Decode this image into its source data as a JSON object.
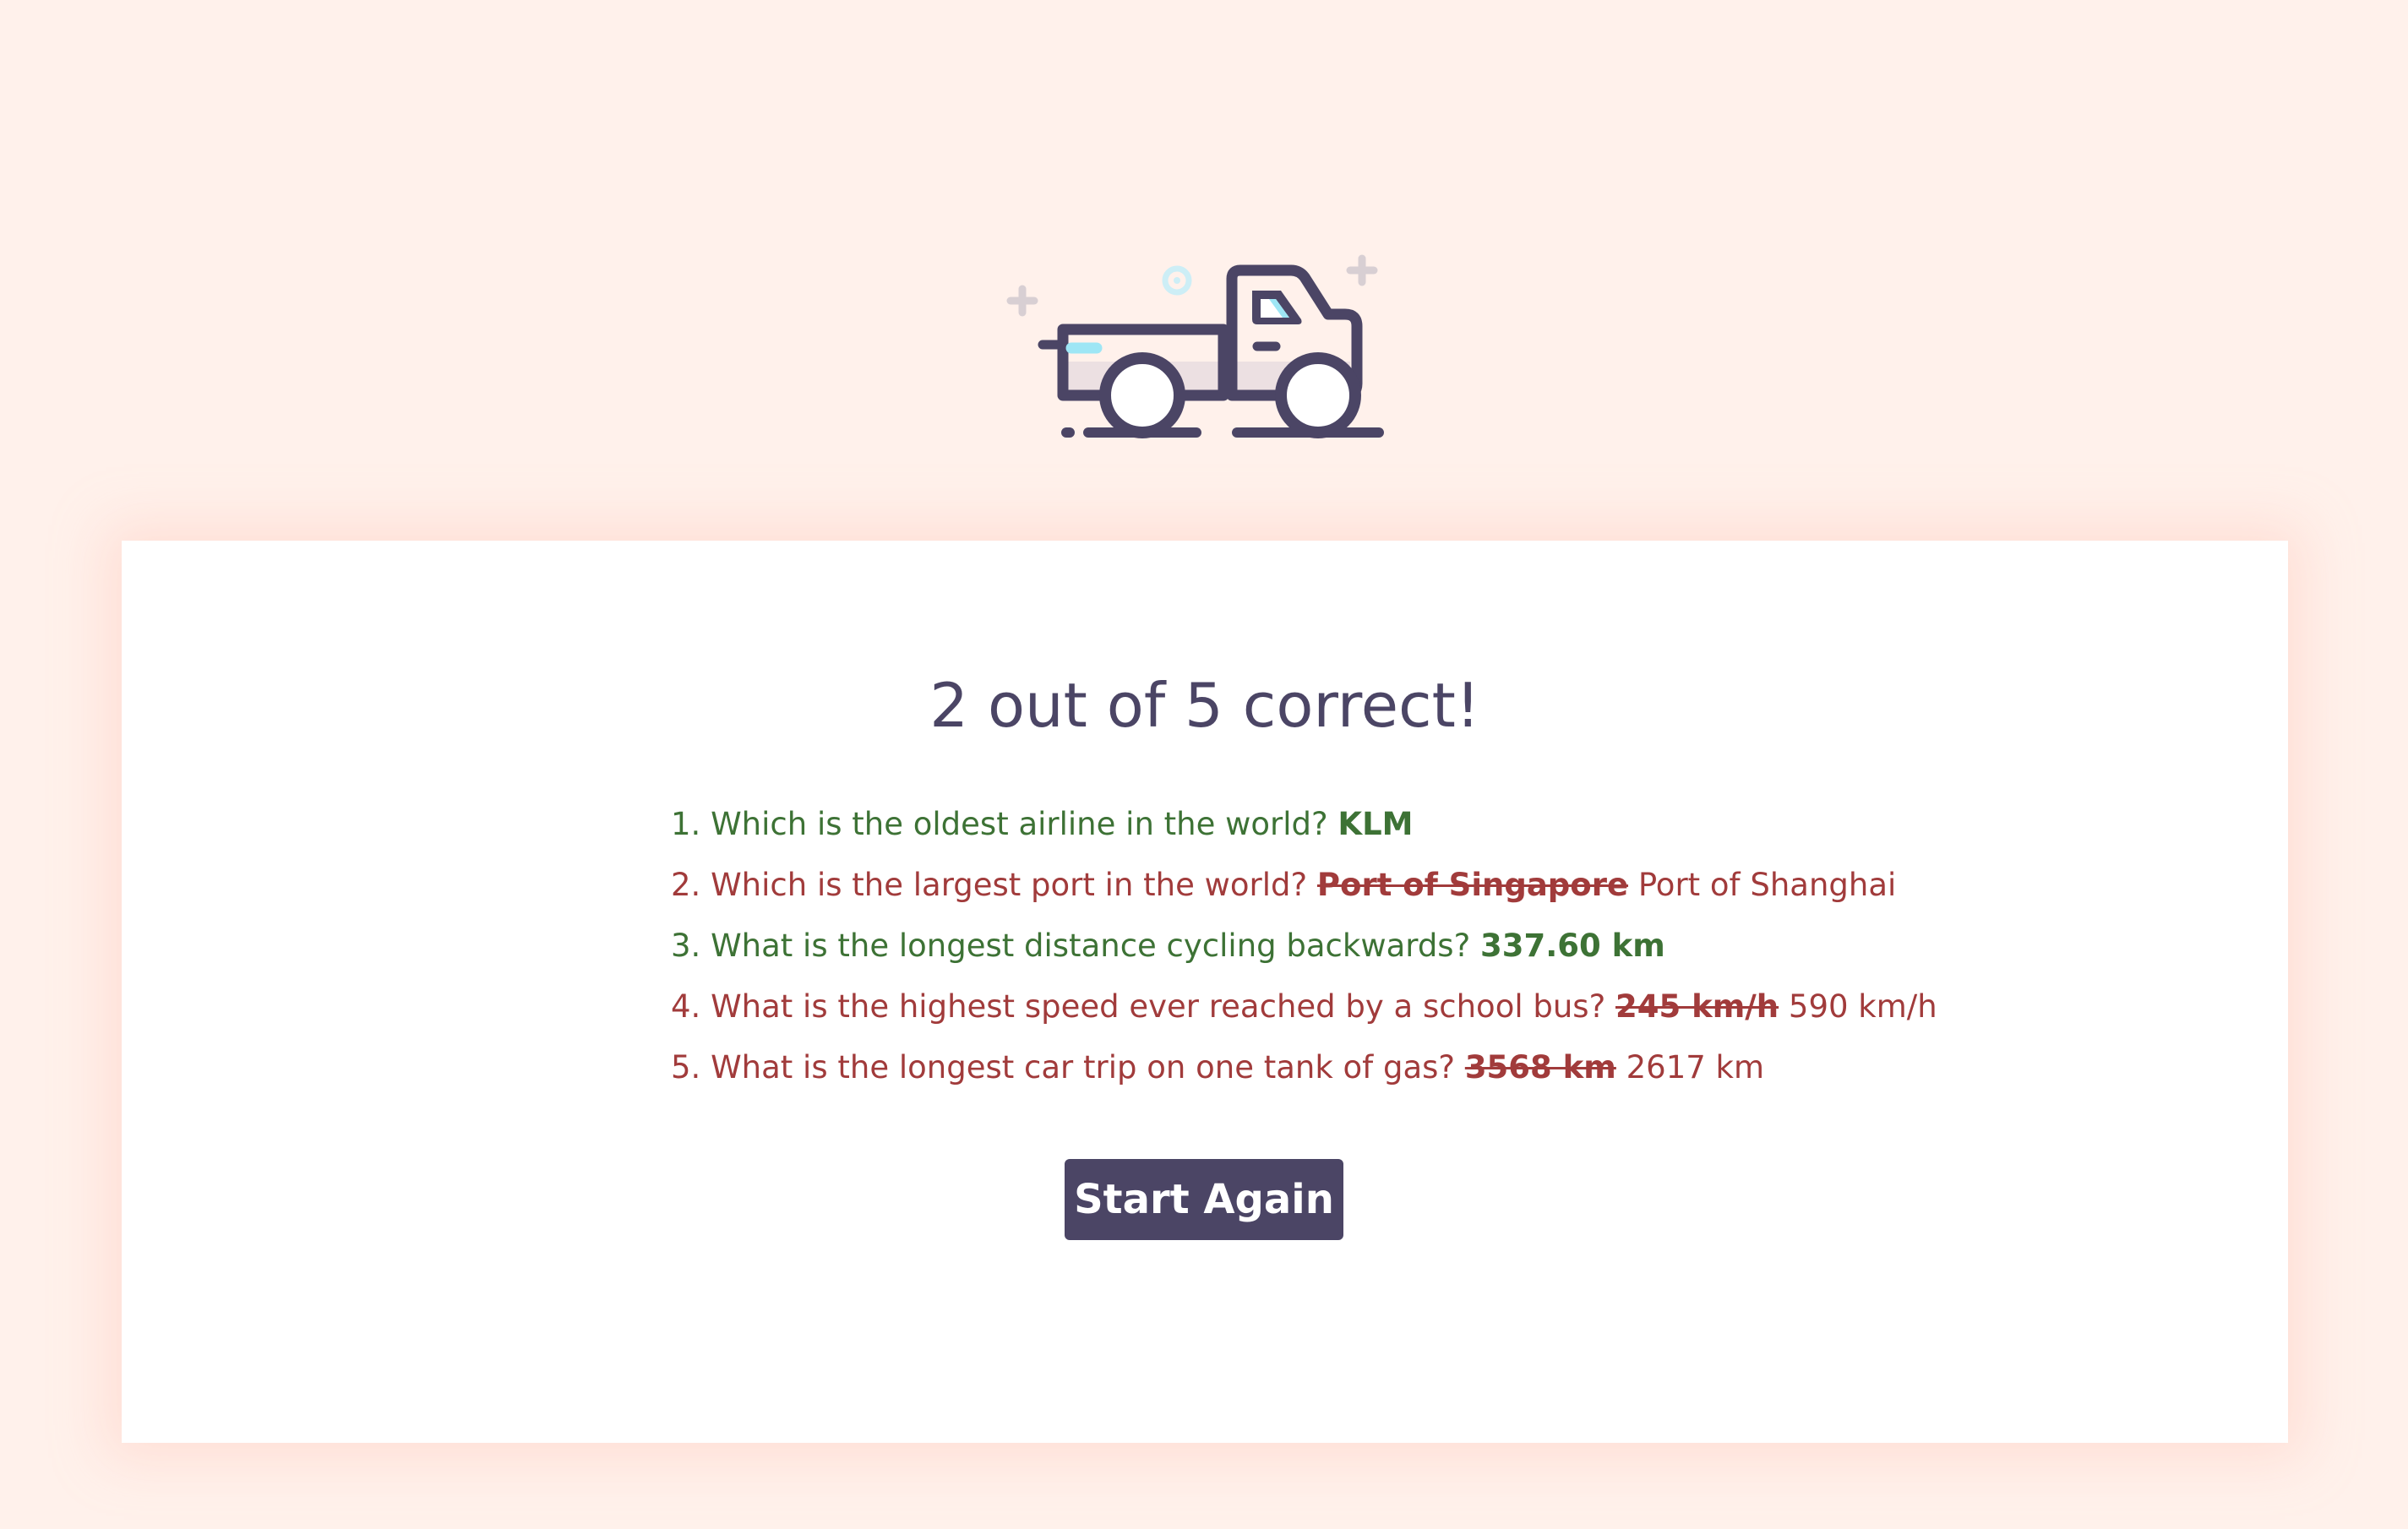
{
  "hero": {
    "icon": "pickup-truck-icon"
  },
  "result": {
    "title": "2 out of 5 correct!",
    "items": [
      {
        "num": "1.",
        "question": "Which is the oldest airline in the world?",
        "status": "correct",
        "correct_answer": "KLM"
      },
      {
        "num": "2.",
        "question": "Which is the largest port in the world?",
        "status": "wrong",
        "given_answer": "Port of Singapore",
        "correct_answer": "Port of Shanghai"
      },
      {
        "num": "3.",
        "question": "What is the longest distance cycling backwards?",
        "status": "correct",
        "correct_answer": "337.60 km"
      },
      {
        "num": "4.",
        "question": "What is the highest speed ever reached by a school bus?",
        "status": "wrong",
        "given_answer": "245 km/h",
        "correct_answer": "590 km/h"
      },
      {
        "num": "5.",
        "question": "What is the longest car trip on one tank of gas?",
        "status": "wrong",
        "given_answer": "3568 km",
        "correct_answer": "2617 km"
      }
    ]
  },
  "actions": {
    "restart_label": "Start Again"
  },
  "colors": {
    "background": "#fff1eb",
    "card": "#ffffff",
    "primary": "#4b4565",
    "correct": "#3d7235",
    "wrong": "#a13b3b",
    "accent_blue": "#9ee6f5"
  }
}
